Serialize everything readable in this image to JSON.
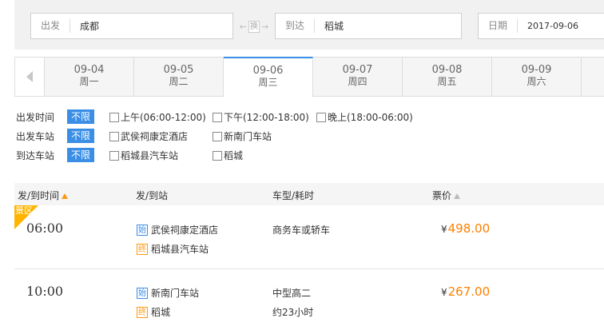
{
  "search": {
    "from_label": "出发",
    "from_value": "成都",
    "swap_label": "换",
    "to_label": "到达",
    "to_value": "稻城",
    "date_label": "日期",
    "date_value": "2017-09-06"
  },
  "date_tabs": [
    {
      "date": "09-04",
      "weekday": "周一"
    },
    {
      "date": "09-05",
      "weekday": "周二"
    },
    {
      "date": "09-06",
      "weekday": "周三"
    },
    {
      "date": "09-07",
      "weekday": "周四"
    },
    {
      "date": "09-08",
      "weekday": "周五"
    },
    {
      "date": "09-09",
      "weekday": "周六"
    }
  ],
  "filters": {
    "unlimited_label": "不限",
    "depart_time": {
      "title": "出发时间",
      "options": [
        "上午(06:00-12:00)",
        "下午(12:00-18:00)",
        "晚上(18:00-06:00)"
      ]
    },
    "depart_station": {
      "title": "出发车站",
      "options": [
        "武侯祠康定酒店",
        "新南门车站"
      ]
    },
    "arrive_station": {
      "title": "到达车站",
      "options": [
        "稻城县汽车站",
        "稻城"
      ]
    }
  },
  "table": {
    "headers": [
      "发/到时间",
      "发/到站",
      "车型/耗时",
      "票价"
    ],
    "currency": "¥",
    "start_tag": "始",
    "end_tag": "终",
    "rows": [
      {
        "badge": "景区",
        "time": "06:00",
        "from": "武侯祠康定酒店",
        "to": "稻城县汽车站",
        "vehicle": "商务车或轿车",
        "duration": "",
        "price": "498.00"
      },
      {
        "badge": "",
        "time": "10:00",
        "from": "新南门车站",
        "to": "稻城",
        "vehicle": "中型高二",
        "duration": "约23小时",
        "price": "267.00"
      }
    ]
  },
  "colors": {
    "accent": "#3a8ee6",
    "price": "#ff7f00",
    "badge": "#ffb400",
    "sort_arrow": "#ff9913"
  }
}
